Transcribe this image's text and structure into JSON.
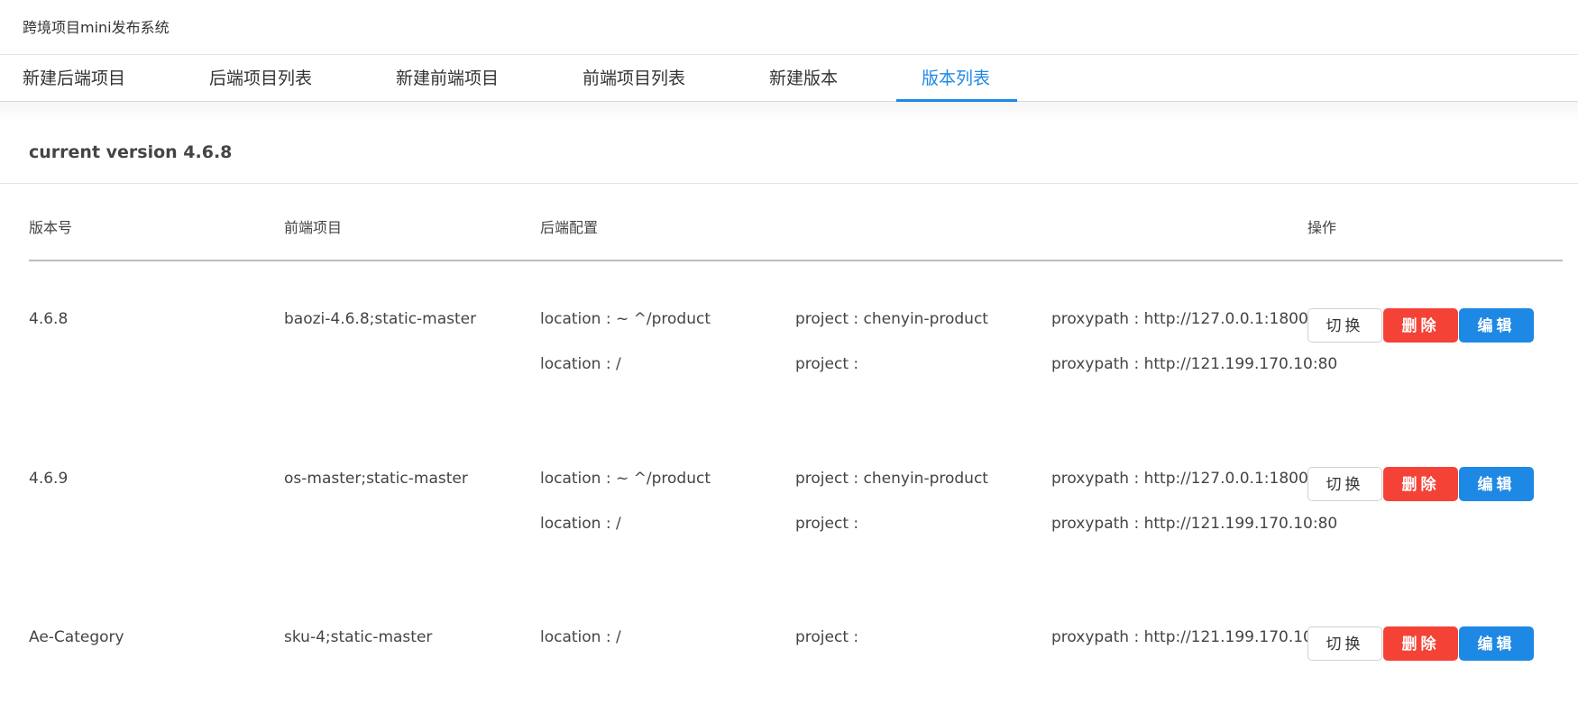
{
  "app": {
    "title": "跨境项目mini发布系统"
  },
  "tabs": [
    {
      "label": "新建后端项目"
    },
    {
      "label": "后端项目列表"
    },
    {
      "label": "新建前端项目"
    },
    {
      "label": "前端项目列表"
    },
    {
      "label": "新建版本"
    },
    {
      "label": "版本列表",
      "active": true
    }
  ],
  "colors": {
    "accent": "#1e88e5",
    "danger": "#f44336",
    "divider": "#bdbdbd"
  },
  "section": {
    "title": "current version 4.6.8"
  },
  "table": {
    "headers": {
      "version": "版本号",
      "frontend": "前端项目",
      "backend": "后端配置",
      "actions": "操作"
    },
    "buttons": {
      "switch": "切换",
      "delete": "删除",
      "edit": "编辑"
    },
    "rows": [
      {
        "version": "4.6.8",
        "frontend": "baozi-4.6.8;static-master",
        "configs": [
          {
            "location": "location : ~ ^/product",
            "project": "project : chenyin-product",
            "proxypath": "proxypath : http://127.0.0.1:18000"
          },
          {
            "location": "location : /",
            "project": "project :",
            "proxypath": "proxypath : http://121.199.170.10:80"
          }
        ]
      },
      {
        "version": "4.6.9",
        "frontend": "os-master;static-master",
        "configs": [
          {
            "location": "location : ~ ^/product",
            "project": "project : chenyin-product",
            "proxypath": "proxypath : http://127.0.0.1:18000"
          },
          {
            "location": "location : /",
            "project": "project :",
            "proxypath": "proxypath : http://121.199.170.10:80"
          }
        ]
      },
      {
        "version": "Ae-Category",
        "frontend": "sku-4;static-master",
        "configs": [
          {
            "location": "location : /",
            "project": "project :",
            "proxypath": "proxypath : http://121.199.170.10:80"
          }
        ]
      }
    ]
  }
}
